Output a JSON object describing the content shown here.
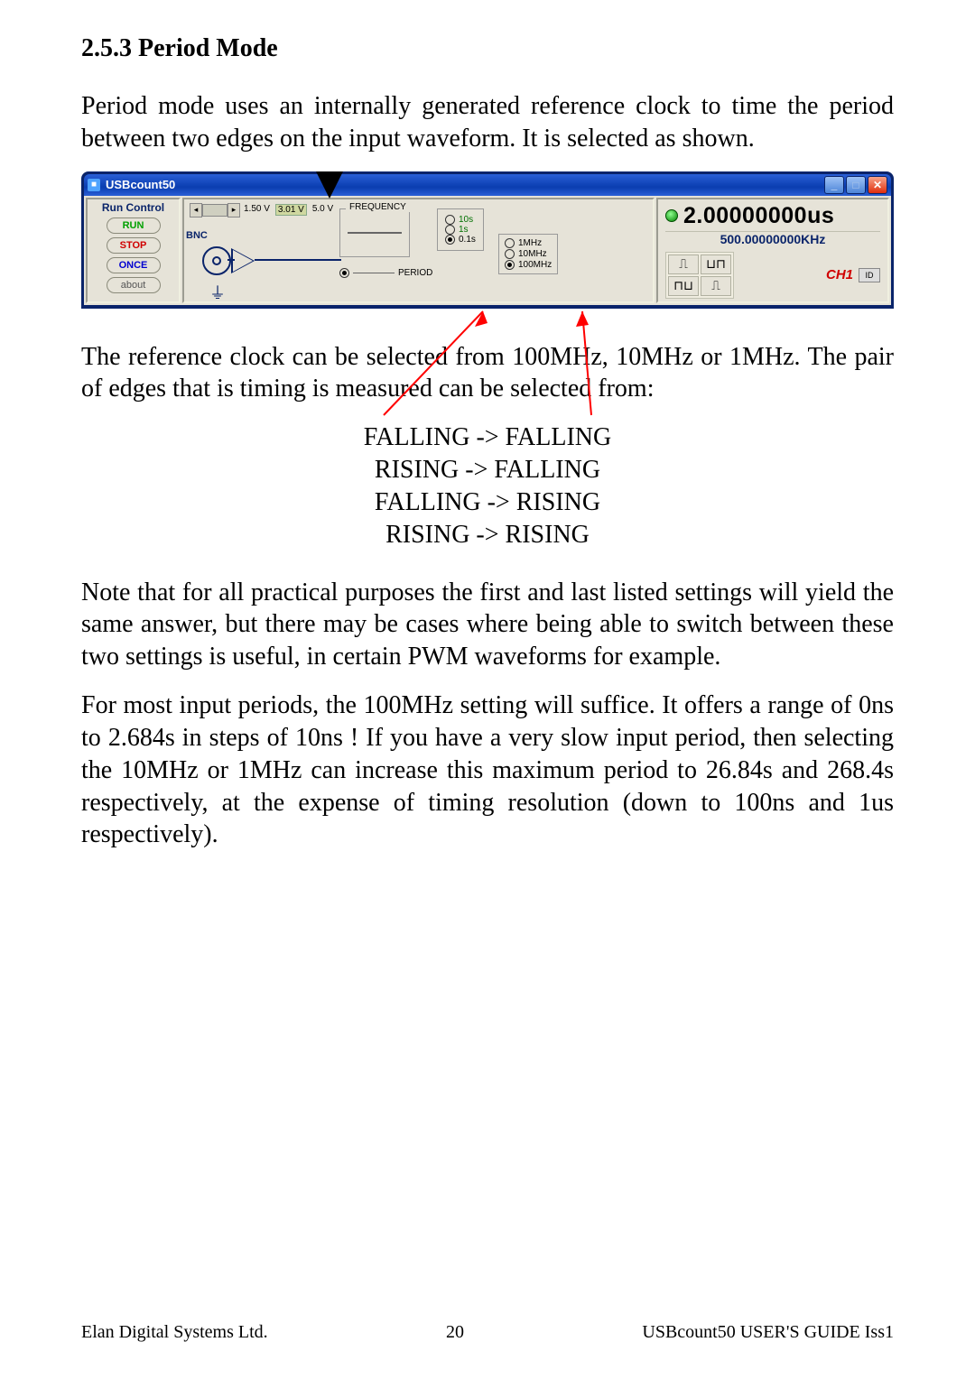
{
  "heading": "2.5.3  Period Mode",
  "para1": "Period mode uses an internally generated reference clock to time the period between two edges on the input waveform.  It is selected as shown.",
  "para2": "The reference clock can be selected from 100MHz, 10MHz or 1MHz.  The pair of edges that is timing is measured can be selected from:",
  "edgeopts": {
    "l1": "FALLING -> FALLING",
    "l2": "RISING -> FALLING",
    "l3": "FALLING -> RISING",
    "l4": "RISING -> RISING"
  },
  "para3": "Note that for all practical purposes the first and last listed settings will yield the same answer, but there may be cases where being able to switch between these two settings is useful, in certain PWM waveforms for example.",
  "para4": "For most input periods, the 100MHz setting will suffice.  It offers a range of 0ns to 2.684s in steps of 10ns !  If you have a very slow input period, then selecting the 10MHz or 1MHz can increase this maximum period to 26.84s and 268.4s respectively, at the expense of timing resolution (down to 100ns and 1us respectively).",
  "window": {
    "title": "USBcount50",
    "runControl": {
      "label": "Run Control",
      "run": "RUN",
      "stop": "STOP",
      "once": "ONCE",
      "about": "about"
    },
    "threshold": {
      "ticks": [
        "1.50 V",
        "3.01 V",
        "5.0 V"
      ]
    },
    "freq": {
      "label": "FREQUENCY"
    },
    "period": {
      "label": "PERIOD"
    },
    "gate": {
      "opts": [
        "10s",
        "1s",
        "0.1s"
      ],
      "selected": 2
    },
    "ref": {
      "opts": [
        "1MHz",
        "10MHz",
        "100MHz"
      ],
      "selected": 2
    },
    "bnc": "BNC",
    "display": {
      "value": "2.00000000us",
      "freq": "500.00000000KHz",
      "ch": "CH1",
      "id": "ID"
    },
    "edgeGlyphs": {
      "ff": "⎍",
      "rf": "⊔⊓",
      "fr": "⊓⊔",
      "rr": "⎍"
    }
  },
  "footer": {
    "left": "Elan Digital Systems Ltd.",
    "center": "20",
    "right": "USBcount50 USER'S GUIDE Iss1"
  }
}
